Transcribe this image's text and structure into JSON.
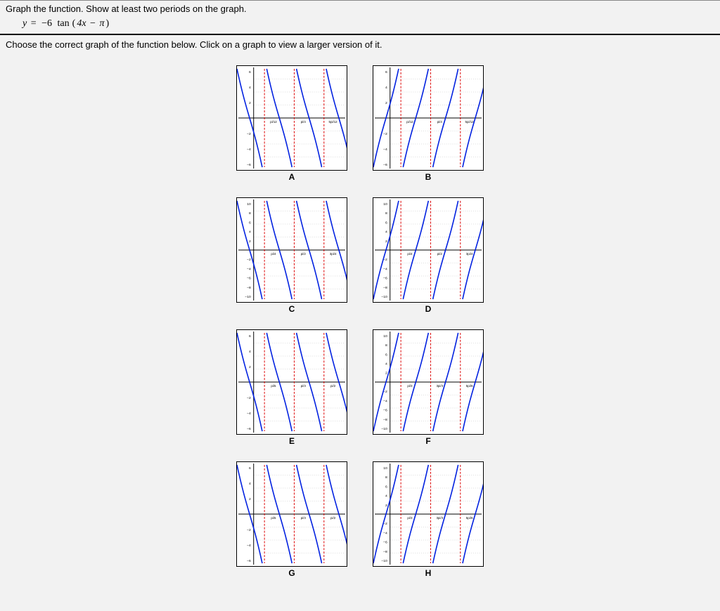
{
  "question": {
    "prompt": "Graph the function. Show at least two periods on the graph.",
    "equation_parts": {
      "y": "y",
      "eq": "=",
      "neg6": "−6",
      "tan": "tan",
      "lparen": "(",
      "four_x": "4x",
      "minus": "−",
      "pi": "π",
      "rparen": ")"
    }
  },
  "instruction": "Choose the correct graph of the function below. Click on a graph to view a larger version of it.",
  "graph_options": [
    {
      "label": "A",
      "direction": "down",
      "y_scale": 6,
      "xticks": [
        "pi/12",
        "pi/4",
        "5pi/12"
      ]
    },
    {
      "label": "B",
      "direction": "up",
      "y_scale": 6,
      "xticks": [
        "pi/12",
        "pi/4",
        "5pi/12"
      ]
    },
    {
      "label": "C",
      "direction": "down",
      "y_scale": 10,
      "xticks": [
        "pi/4",
        "pi/2",
        "3pi/4"
      ]
    },
    {
      "label": "D",
      "direction": "up",
      "y_scale": 10,
      "xticks": [
        "pi/4",
        "pi/2",
        "3pi/4"
      ]
    },
    {
      "label": "E",
      "direction": "down",
      "y_scale": 6,
      "xticks": [
        "pi/5",
        "pi/3",
        "pi/2"
      ]
    },
    {
      "label": "F",
      "direction": "up",
      "y_scale": 10,
      "xticks": [
        "pi/3",
        "3pi/3",
        "5pi/6"
      ]
    },
    {
      "label": "G",
      "direction": "down",
      "y_scale": 6,
      "xticks": [
        "pi/5",
        "pi/3",
        "pi/2"
      ]
    },
    {
      "label": "H",
      "direction": "up",
      "y_scale": 10,
      "xticks": [
        "pi/3",
        "3pi/3",
        "5pi/6"
      ]
    }
  ]
}
